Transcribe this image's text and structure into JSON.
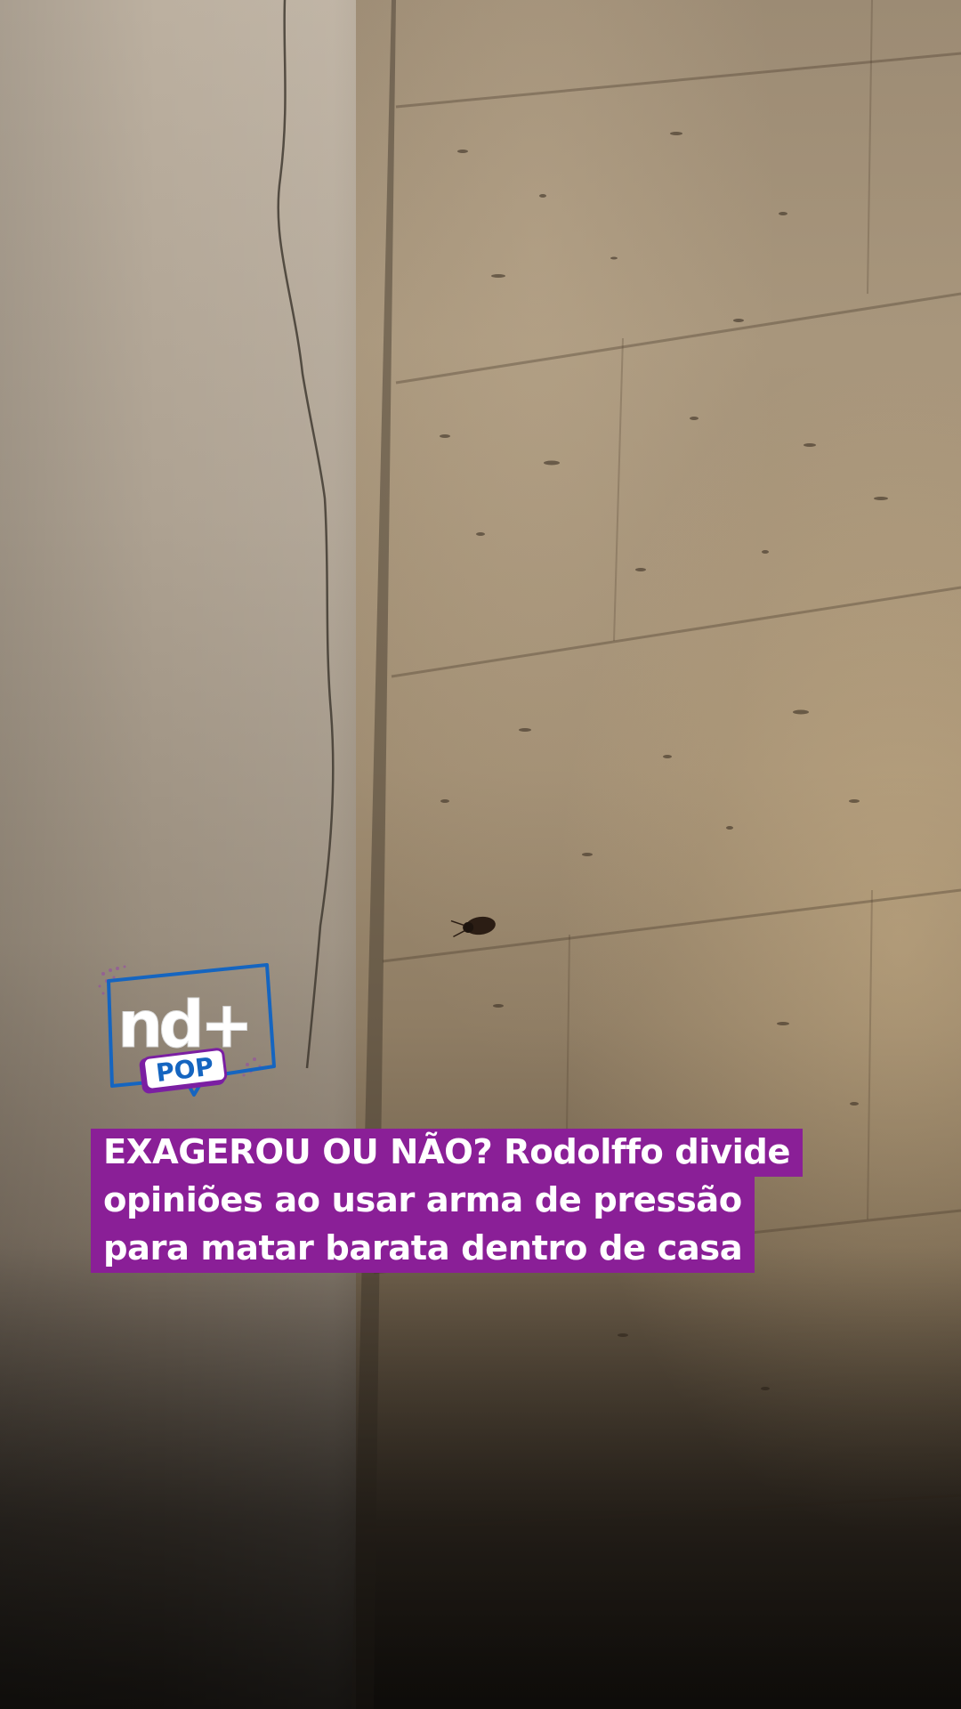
{
  "logo": {
    "brand_text": "nd+",
    "sub_text": "POP"
  },
  "headline": {
    "line1": "EXAGEROU OU NÃO? Rodolffo divide",
    "line2": "opiniões ao usar arma de pressão",
    "line3": "para matar barata dentro de casa"
  },
  "colors": {
    "headline_bg": "#8a1f97",
    "headline_text": "#ffffff",
    "logo_blue": "#1565c0",
    "logo_purple": "#7b1fa2"
  }
}
